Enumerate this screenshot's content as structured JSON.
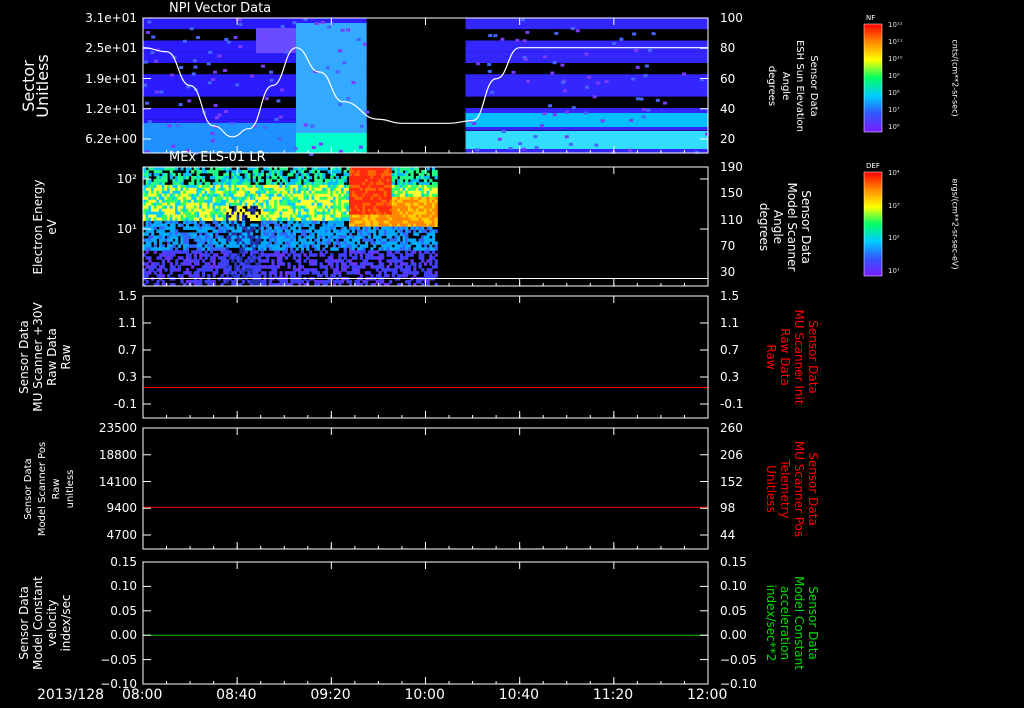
{
  "chart_data": [
    {
      "type": "heatmap",
      "title": "NPI Vector Data",
      "ylabel": "Sector\nUnitless",
      "yticks": [
        "3.1e+01",
        "2.5e+01",
        "1.9e+01",
        "1.2e+01",
        "6.2e+00"
      ],
      "ylabel_right": "Sensor Data\nESH Sun Elevation\nAngle\ndegrees",
      "yticks_right": [
        "100",
        "80",
        "60",
        "40",
        "20"
      ],
      "ylim_right": [
        0,
        100
      ],
      "overlay_line": {
        "name": "Sensor Data ESH Sun Elevation Angle",
        "x": [
          "08:00",
          "08:10",
          "08:20",
          "08:30",
          "08:38",
          "08:45",
          "08:55",
          "09:05",
          "09:15",
          "09:25",
          "09:40",
          "09:50",
          "10:00",
          "10:10",
          "10:20",
          "10:30",
          "10:40",
          "12:00"
        ],
        "y": [
          78,
          75,
          50,
          20,
          12,
          18,
          50,
          78,
          60,
          38,
          25,
          22,
          22,
          22,
          24,
          55,
          78,
          78
        ]
      },
      "data_gap": [
        "09:35",
        "10:17"
      ],
      "colorbar": {
        "label": "NF",
        "units": "cnts/(cm**2-sr-sec)",
        "ticks": [
          "10¹²",
          "10¹¹",
          "10¹⁰",
          "10⁹",
          "10⁸",
          "10⁷",
          "10⁶"
        ]
      }
    },
    {
      "type": "heatmap",
      "title": "MEx ELS-01 LR",
      "ylabel": "Electron Energy\neV",
      "yticks": [
        "10²",
        "10¹"
      ],
      "ylabel_right": "Sensor Data\nModel Scanner\nAngle\ndegrees",
      "yticks_right": [
        "190",
        "150",
        "110",
        "70",
        "30"
      ],
      "ylim_right": [
        0,
        190
      ],
      "overlay_line": {
        "name": "Sensor Data Model Scanner Angle",
        "x": [
          "08:00",
          "12:00"
        ],
        "y": [
          12,
          12
        ]
      },
      "data_end": "10:05",
      "colorbar": {
        "label": "DEF",
        "units": "ergs/(cm**2-sr-sec-eV)",
        "ticks": [
          "10⁴",
          "10³",
          "10²",
          "10¹"
        ]
      }
    },
    {
      "type": "line",
      "ylabel": "Sensor Data\nMU Scanner +30V\nRaw Data\nRaw",
      "yticks": [
        "1.5",
        "1.1",
        "0.7",
        "0.3",
        "-0.1"
      ],
      "ylim": [
        -0.5,
        1.5
      ],
      "ylabel_right": "Sensor Data\nMU Scanner Init\nRaw Data\nRaw",
      "yticks_right": [
        "1.5",
        "1.1",
        "0.7",
        "0.3",
        "-0.1"
      ],
      "ylim_right": [
        -0.5,
        1.5
      ],
      "right_color": "#ff0000",
      "series": [
        {
          "color": "#ff0000",
          "x": [
            "08:00",
            "12:00"
          ],
          "y": [
            0.0,
            0.0
          ]
        }
      ]
    },
    {
      "type": "line",
      "ylabel": "Sensor Data\nModel Scanner Pos\nRaw\nunitless",
      "yticks": [
        "23500",
        "18800",
        "14100",
        "9400",
        "4700"
      ],
      "ylim": [
        0,
        23500
      ],
      "ylabel_right": "Sensor Data\nMU Scanner Pos\nTelemetry\nUnitless",
      "yticks_right": [
        "260",
        "206",
        "152",
        "98",
        "44"
      ],
      "ylim_right": [
        -10,
        260
      ],
      "right_color": "#ff0000",
      "series": [
        {
          "color": "#ff0000",
          "x": [
            "08:00",
            "12:00"
          ],
          "y": [
            8100,
            8100
          ]
        }
      ]
    },
    {
      "type": "line",
      "ylabel": "Sensor Data\nModel Constant\nvelocity\nindex/sec",
      "yticks": [
        "0.15",
        "0.10",
        "0.05",
        "0.00",
        "−0.05",
        "−0.10"
      ],
      "ylim": [
        -0.1,
        0.15
      ],
      "ylabel_right": "Sensor Data\nModel Constant\nacceleration\nindex/sec**2",
      "yticks_right": [
        "0.15",
        "0.10",
        "0.05",
        "0.00",
        "−0.05",
        "−0.10"
      ],
      "ylim_right": [
        -0.1,
        0.15
      ],
      "right_color": "#00dd00",
      "series": [
        {
          "color": "#00cc00",
          "x": [
            "08:00",
            "12:00"
          ],
          "y": [
            0.0,
            0.0
          ]
        }
      ]
    }
  ],
  "xaxis": {
    "date": "2013/128",
    "ticks": [
      "08:00",
      "08:40",
      "09:20",
      "10:00",
      "10:40",
      "11:20",
      "12:00"
    ],
    "range": [
      "08:00",
      "12:00"
    ]
  },
  "colors": {
    "background": "#000000",
    "axis": "#ffffff"
  }
}
